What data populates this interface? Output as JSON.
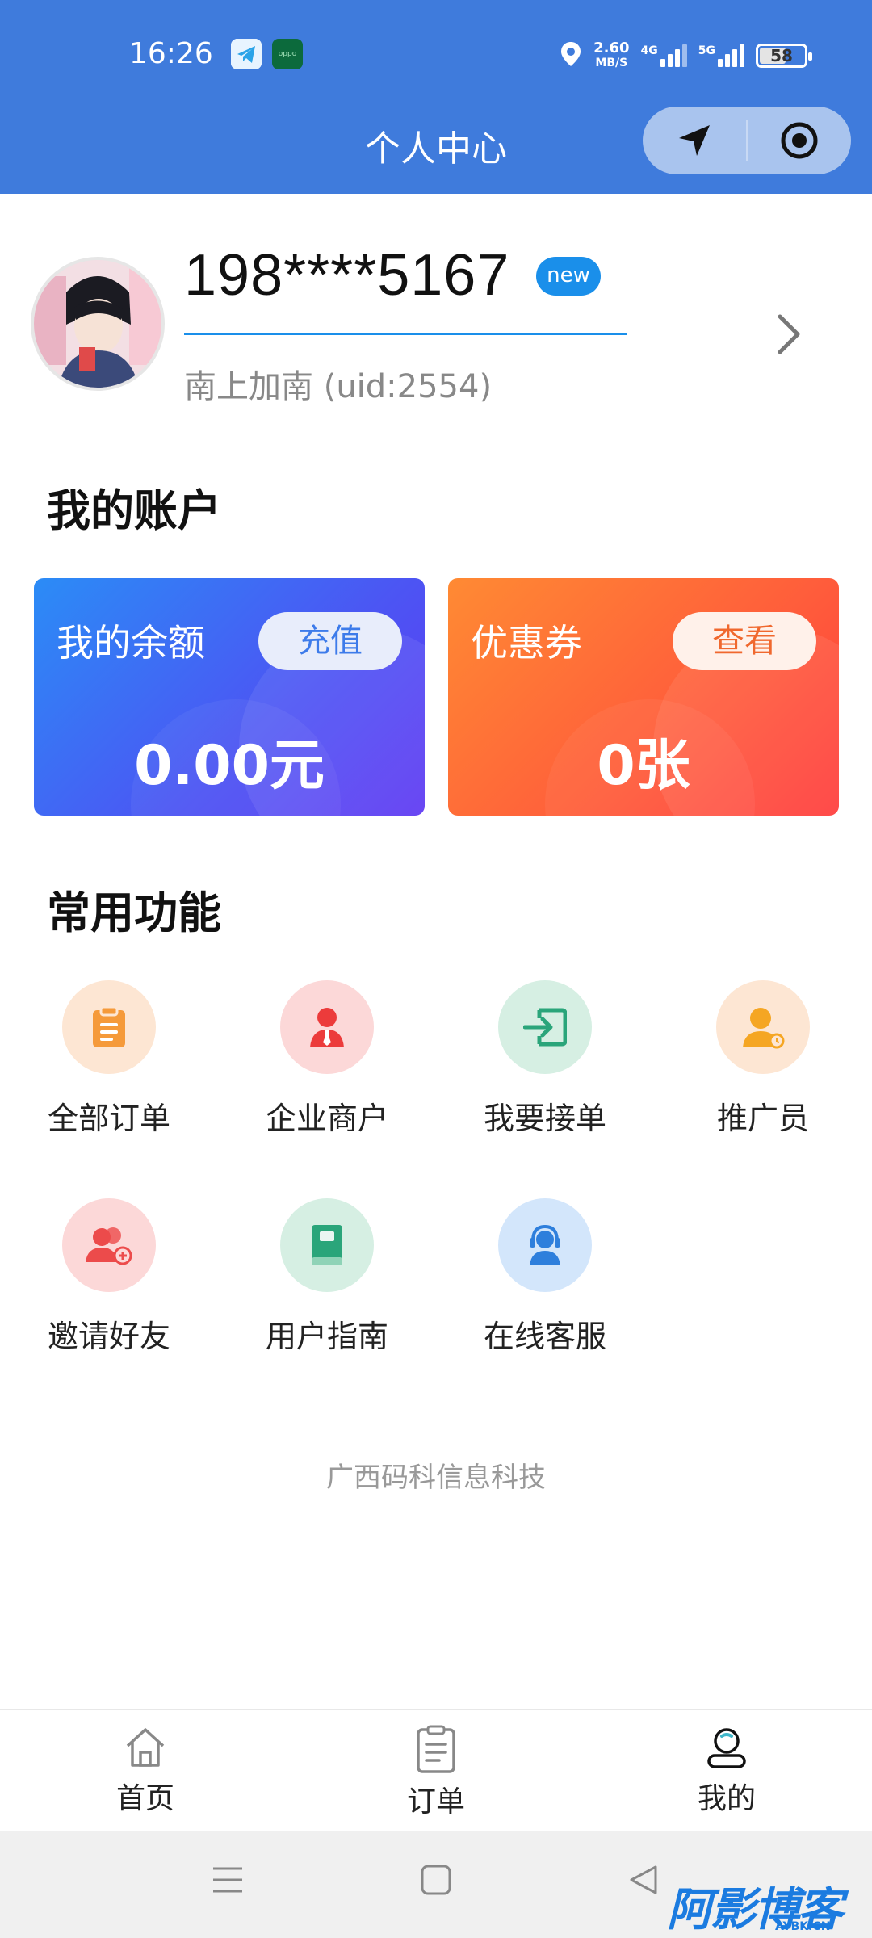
{
  "status_bar": {
    "time": "16:26",
    "net_speed_value": "2.60",
    "net_speed_unit": "MB/S",
    "signal1_label": "4G",
    "signal2_label": "5G",
    "battery": "58",
    "oppo_label": "oppo"
  },
  "nav": {
    "title": "个人中心"
  },
  "profile": {
    "phone": "198****5167",
    "badge": "new",
    "username": "南上加南 (uid:2554)"
  },
  "account": {
    "section_title": "我的账户",
    "balance_label": "我的余额",
    "balance_button": "充值",
    "balance_value": "0.00元",
    "coupon_label": "优惠券",
    "coupon_button": "查看",
    "coupon_value": "0张"
  },
  "functions": {
    "section_title": "常用功能",
    "items": [
      {
        "label": "全部订单",
        "icon": "clipboard-icon",
        "bg": "#fde6d3",
        "color": "#f59a3a"
      },
      {
        "label": "企业商户",
        "icon": "business-person-icon",
        "bg": "#fcd8d8",
        "color": "#ec3b3b"
      },
      {
        "label": "我要接单",
        "icon": "login-box-icon",
        "bg": "#d6efe3",
        "color": "#2aa57a"
      },
      {
        "label": "推广员",
        "icon": "promoter-icon",
        "bg": "#fde6d3",
        "color": "#f5a623"
      },
      {
        "label": "邀请好友",
        "icon": "invite-users-icon",
        "bg": "#fcd8d8",
        "color": "#ec4b4b"
      },
      {
        "label": "用户指南",
        "icon": "book-icon",
        "bg": "#d6efe3",
        "color": "#2aa57a"
      },
      {
        "label": "在线客服",
        "icon": "headset-icon",
        "bg": "#d3e6fb",
        "color": "#2e7fdc"
      }
    ]
  },
  "footer": {
    "company": "广西码科信息科技"
  },
  "tabbar": {
    "items": [
      {
        "label": "首页",
        "icon": "home-icon"
      },
      {
        "label": "订单",
        "icon": "order-list-icon"
      },
      {
        "label": "我的",
        "icon": "user-icon"
      }
    ]
  },
  "watermark": {
    "text": "阿影博客",
    "sub": "AYBK.CN"
  }
}
